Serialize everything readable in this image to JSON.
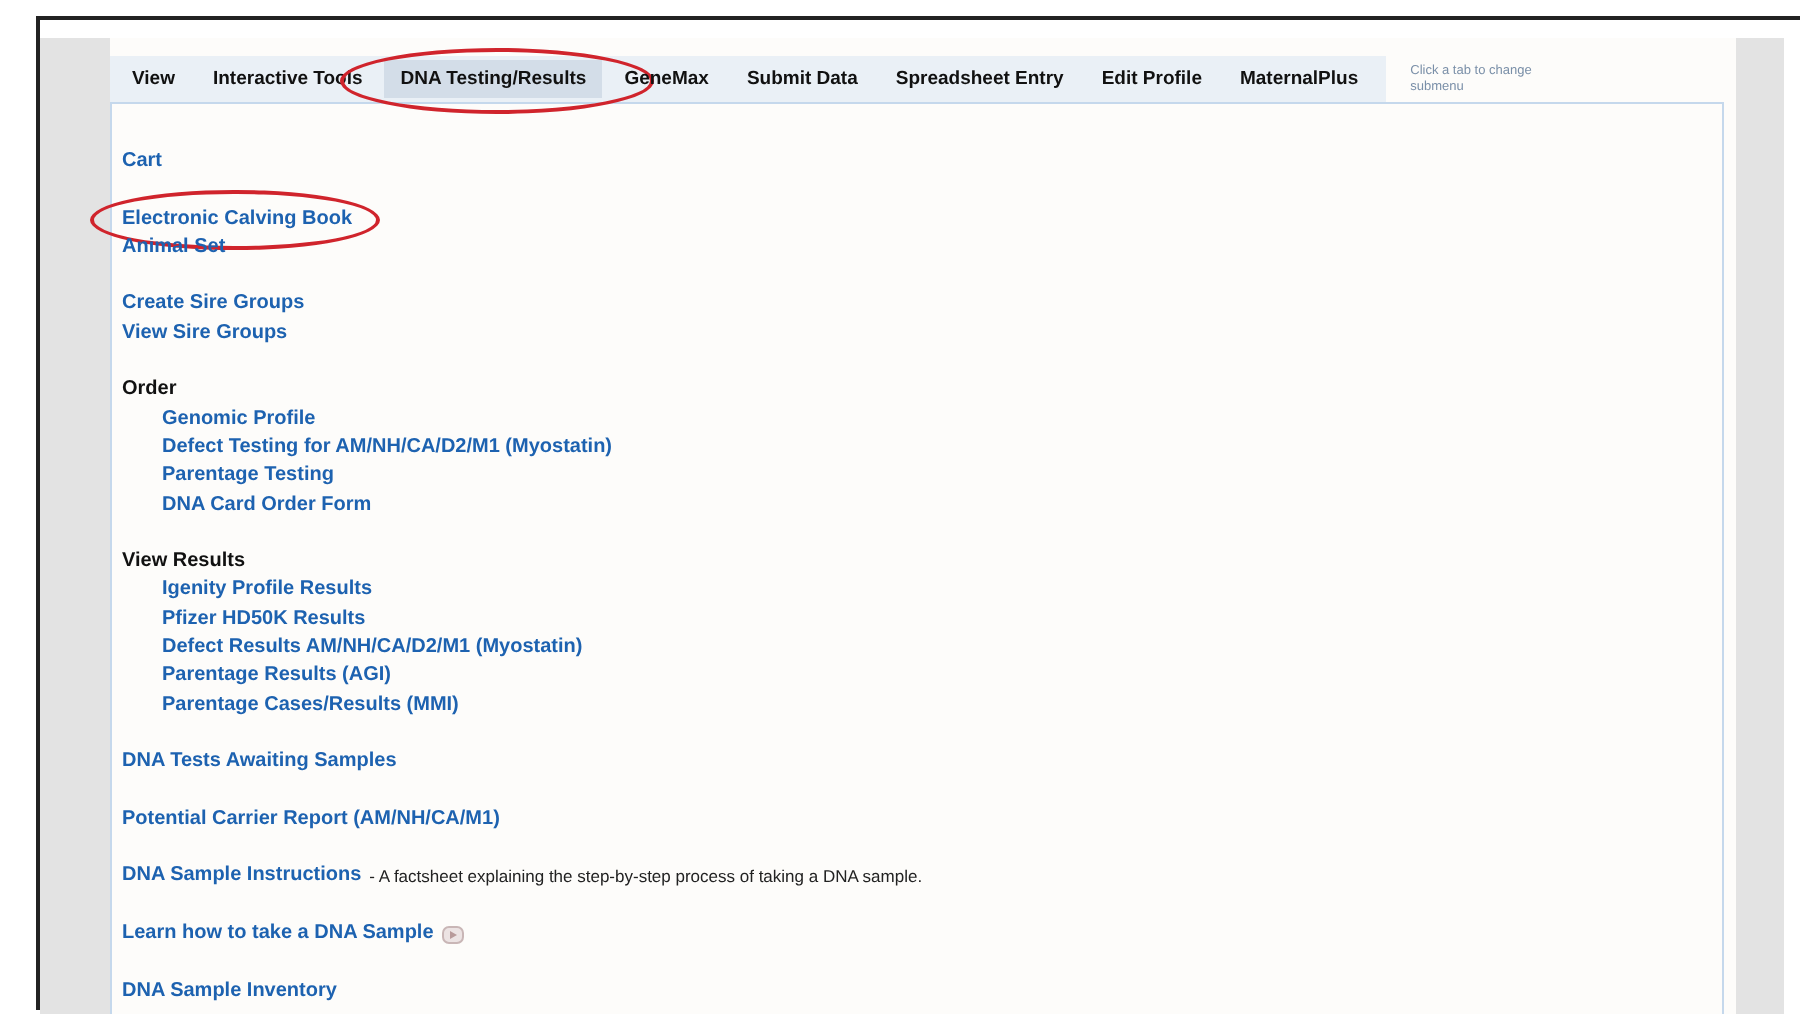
{
  "tabs": [
    {
      "label": "View",
      "selected": false,
      "highlighted": false
    },
    {
      "label": "Interactive Tools",
      "selected": false,
      "highlighted": false
    },
    {
      "label": "DNA Testing/Results",
      "selected": true,
      "highlighted": true
    },
    {
      "label": "GeneMax",
      "selected": false,
      "highlighted": false
    },
    {
      "label": "Submit Data",
      "selected": false,
      "highlighted": false
    },
    {
      "label": "Spreadsheet Entry",
      "selected": false,
      "highlighted": false
    },
    {
      "label": "Edit Profile",
      "selected": false,
      "highlighted": false
    },
    {
      "label": "MaternalPlus",
      "selected": false,
      "highlighted": false
    }
  ],
  "tab_hint": "Click a tab to change submenu",
  "menu": [
    {
      "items": [
        {
          "label": "Cart"
        }
      ]
    },
    {
      "items": [
        {
          "label": "Electronic Calving Book",
          "highlighted": true
        },
        {
          "label": "Animal Set"
        }
      ]
    },
    {
      "items": [
        {
          "label": "Create Sire Groups"
        },
        {
          "label": "View Sire Groups"
        }
      ]
    },
    {
      "heading": "Order",
      "items": [
        {
          "label": "Genomic Profile"
        },
        {
          "label": "Defect Testing for AM/NH/CA/D2/M1 (Myostatin)"
        },
        {
          "label": "Parentage Testing"
        },
        {
          "label": "DNA Card Order Form"
        }
      ]
    },
    {
      "heading": "View Results",
      "items": [
        {
          "label": "Igenity Profile Results"
        },
        {
          "label": "Pfizer HD50K Results"
        },
        {
          "label": "Defect Results AM/NH/CA/D2/M1 (Myostatin)"
        },
        {
          "label": "Parentage Results (AGI)"
        },
        {
          "label": "Parentage Cases/Results (MMI)"
        }
      ]
    },
    {
      "items": [
        {
          "label": "DNA Tests Awaiting Samples"
        }
      ]
    },
    {
      "items": [
        {
          "label": "Potential Carrier Report (AM/NH/CA/M1)"
        }
      ]
    },
    {
      "items": [
        {
          "label": "DNA Sample Instructions",
          "description": "- A factsheet explaining the step-by-step process of taking a DNA sample."
        }
      ]
    },
    {
      "items": [
        {
          "label": "Learn how to take a DNA Sample",
          "video": true
        }
      ]
    },
    {
      "items": [
        {
          "label": "DNA Sample Inventory"
        }
      ]
    }
  ]
}
